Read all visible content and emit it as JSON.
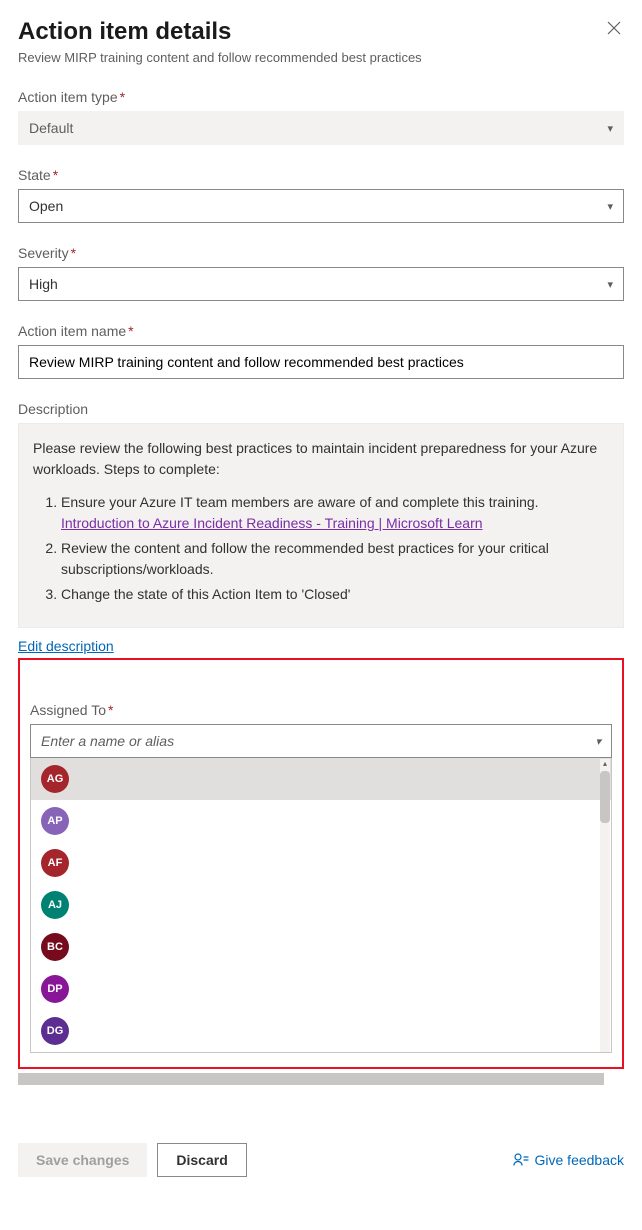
{
  "header": {
    "title": "Action item details",
    "subtitle": "Review MIRP training content and follow recommended best practices"
  },
  "fields": {
    "type": {
      "label": "Action item type",
      "value": "Default"
    },
    "state": {
      "label": "State",
      "value": "Open"
    },
    "severity": {
      "label": "Severity",
      "value": "High"
    },
    "name": {
      "label": "Action item name",
      "value": "Review MIRP training content and follow recommended best practices"
    },
    "description": {
      "label": "Description",
      "intro": "Please review the following best practices to maintain incident preparedness for your Azure workloads. Steps to complete:",
      "step1_pre": "Ensure your Azure IT team members are aware of and complete this training.",
      "step1_link": "Introduction to Azure Incident Readiness - Training | Microsoft Learn",
      "step2": "Review the content and follow the recommended best practices for your critical subscriptions/workloads.",
      "step3": "Change the state of this Action Item to 'Closed'",
      "edit": "Edit description"
    },
    "assigned": {
      "label": "Assigned To",
      "placeholder": "Enter a name or alias",
      "options": [
        {
          "initials": "AG",
          "color": "#a4262c"
        },
        {
          "initials": "AP",
          "color": "#8764b8"
        },
        {
          "initials": "AF",
          "color": "#a4262c"
        },
        {
          "initials": "AJ",
          "color": "#008272"
        },
        {
          "initials": "BC",
          "color": "#750b1c"
        },
        {
          "initials": "DP",
          "color": "#881798"
        },
        {
          "initials": "DG",
          "color": "#5c2e91"
        }
      ]
    }
  },
  "footer": {
    "save": "Save changes",
    "discard": "Discard",
    "feedback": "Give feedback"
  }
}
